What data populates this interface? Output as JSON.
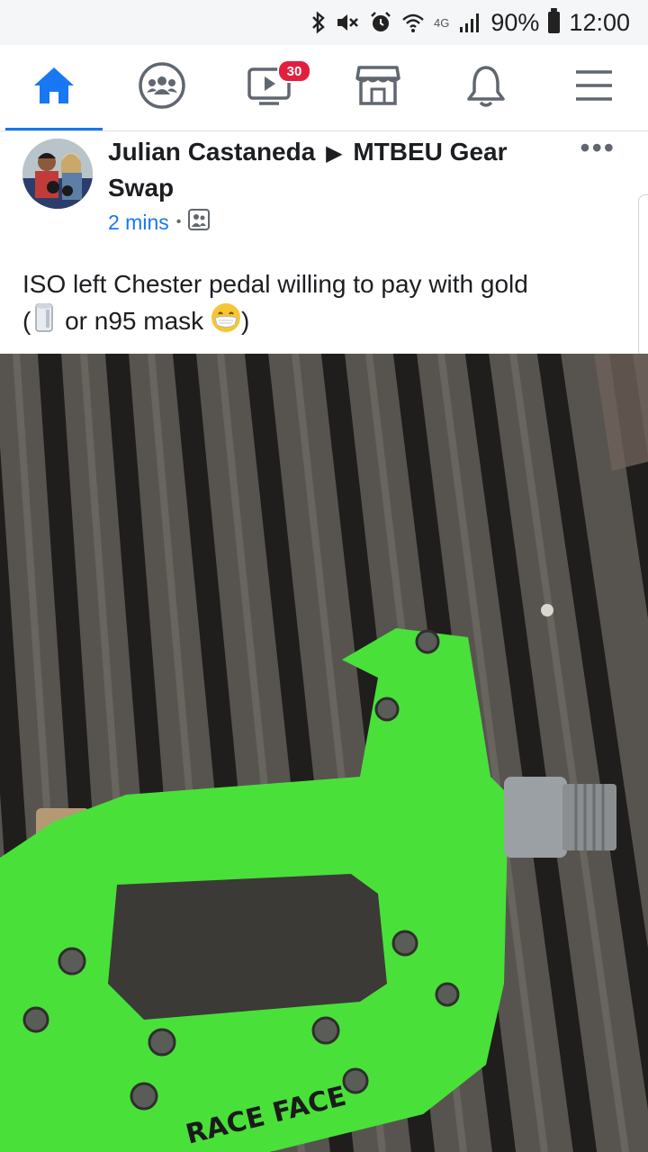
{
  "status_bar": {
    "icons": [
      "bluetooth-icon",
      "mute-icon",
      "alarm-icon",
      "wifi-icon",
      "4g-icon",
      "signal-icon"
    ],
    "network_label": "4G",
    "battery": "90%",
    "time": "12:00"
  },
  "nav": {
    "items": [
      {
        "name": "home",
        "icon": "home-icon",
        "active": true
      },
      {
        "name": "groups",
        "icon": "groups-icon"
      },
      {
        "name": "watch",
        "icon": "watch-icon",
        "badge": "30"
      },
      {
        "name": "marketplace",
        "icon": "marketplace-icon"
      },
      {
        "name": "notifications",
        "icon": "bell-icon"
      },
      {
        "name": "menu",
        "icon": "menu-icon"
      }
    ],
    "watch_badge": "30"
  },
  "post": {
    "author": "Julian Castaneda",
    "group": "MTBEU Gear Swap",
    "time": "2 mins",
    "separator": "•",
    "privacy_icon": "group-members-icon",
    "text_line1": "ISO left Chester pedal  willing to pay with gold",
    "text_open": "(",
    "text_middle": " or n95 mask ",
    "text_close": ")",
    "emojis": [
      "toilet-paper-emoji",
      "mask-face-emoji"
    ],
    "photo_branding": "RACE FACE"
  },
  "colors": {
    "accent": "#1877f2",
    "badge": "#e41e3f",
    "pedal_green": "#49e03a"
  }
}
